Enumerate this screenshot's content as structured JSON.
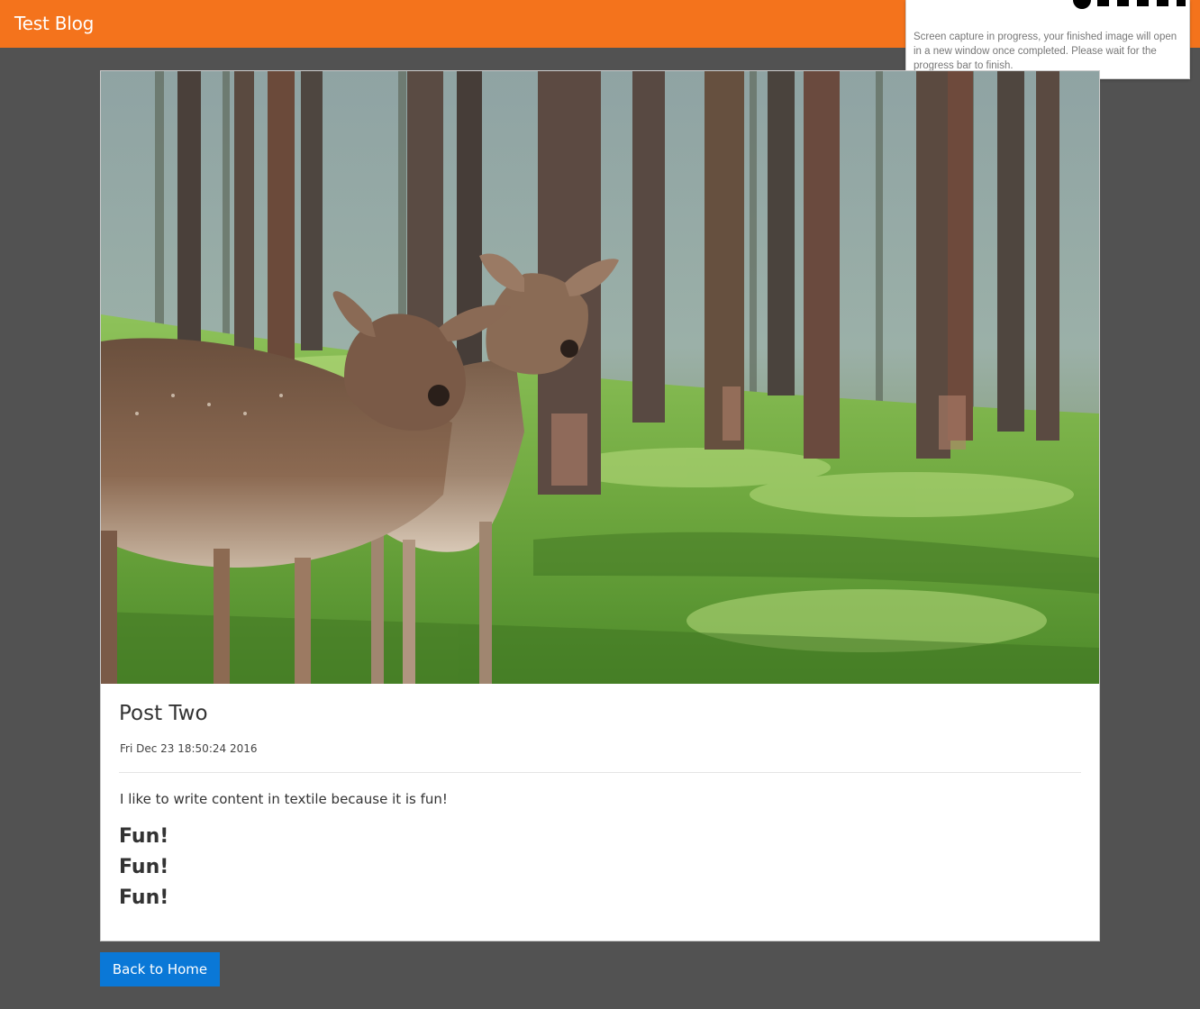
{
  "navbar": {
    "brand": "Test Blog",
    "color": "#f4731c"
  },
  "capture_overlay": {
    "message": "Screen capture in progress, your finished image will open in a new window once completed. Please wait for the progress bar to finish.",
    "progress_icon": "progress-bar-icon"
  },
  "post": {
    "image": "deer-in-forest-photo",
    "title": "Post Two",
    "date": "Fri Dec 23 18:50:24 2016",
    "body": "I like to write content in textile because it is fun!",
    "headings": [
      "Fun!",
      "Fun!",
      "Fun!"
    ]
  },
  "actions": {
    "back_label": "Back to Home",
    "back_color": "#0a78d7"
  }
}
